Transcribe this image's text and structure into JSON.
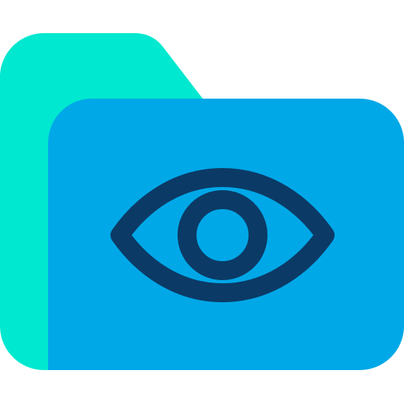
{
  "icon": {
    "name": "folder-eye-icon",
    "colors": {
      "folder_back": "#00E8CF",
      "folder_front": "#00A8E8",
      "eye_stroke": "#0B3A66",
      "background": "#FFFFFF"
    }
  }
}
